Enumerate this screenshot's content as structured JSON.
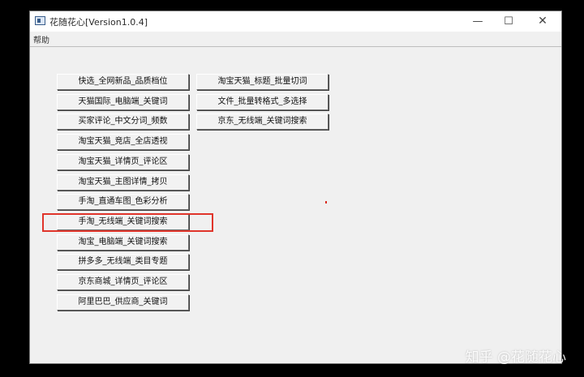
{
  "window": {
    "title": "花随花心[Version1.0.4]",
    "minimize_glyph": "—",
    "maximize_glyph": "☐",
    "close_glyph": "✕"
  },
  "menu": {
    "help_label": "帮助"
  },
  "buttons": {
    "col1": [
      "快选_全网新品_品质档位",
      "天猫国际_电脑端_关键词",
      "买家评论_中文分词_频数",
      "淘宝天猫_竞店_全店透视",
      "淘宝天猫_详情页_评论区",
      "淘宝天猫_主图详情_拷贝",
      "手淘_直通车图_色彩分析",
      "手淘_无线端_关键词搜索",
      "淘宝_电脑端_关键词搜索",
      "拼多多_无线端_类目专题",
      "京东商城_详情页_评论区",
      "阿里巴巴_供应商_关键词"
    ],
    "col2": [
      "淘宝天猫_标题_批量切词",
      "文件_批量转格式_多选择",
      "京东_无线端_关键词搜索"
    ]
  },
  "watermark": "知乎 @花随花心",
  "colors": {
    "highlight": "#e0352b",
    "background": "#000000",
    "window": "#f0f0f0"
  }
}
